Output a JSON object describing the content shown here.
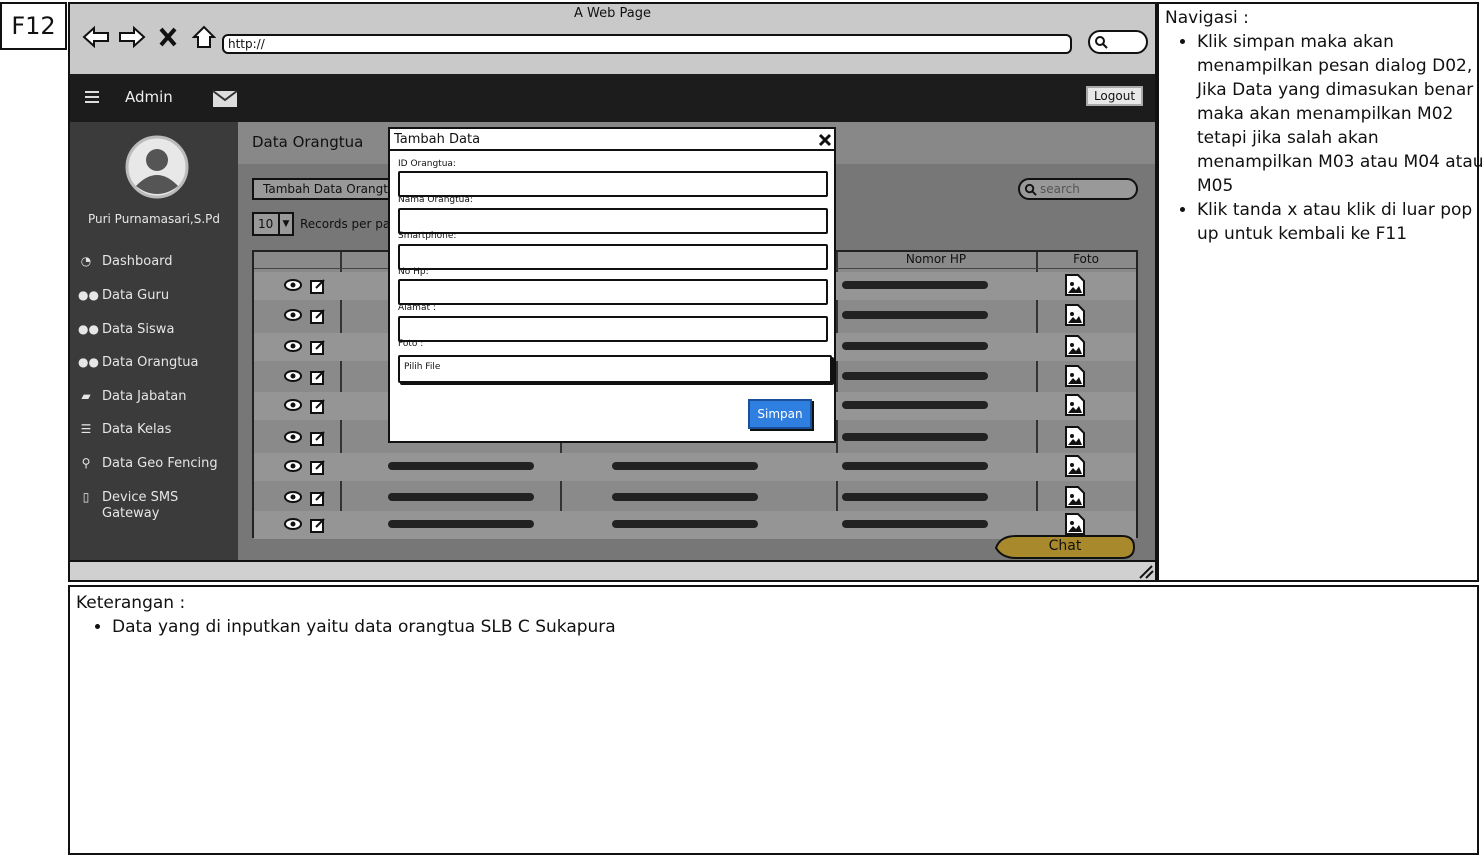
{
  "frame_id": "F12",
  "browser": {
    "title": "A Web Page",
    "url": "http://"
  },
  "topbar": {
    "menu_label": "Admin",
    "logout_label": "Logout"
  },
  "sidebar": {
    "user_name": "Puri Purnamasari,S.Pd",
    "items": [
      {
        "label": "Dashboard",
        "icon": "dashboard-icon"
      },
      {
        "label": "Data Guru",
        "icon": "users-icon"
      },
      {
        "label": "Data Siswa",
        "icon": "users-icon"
      },
      {
        "label": "Data Orangtua",
        "icon": "users-icon"
      },
      {
        "label": "Data Jabatan",
        "icon": "book-icon"
      },
      {
        "label": "Data Kelas",
        "icon": "list-icon"
      },
      {
        "label": "Data Geo Fencing",
        "icon": "map-pin-icon"
      },
      {
        "label": "Device SMS Gateway",
        "icon": "device-icon"
      }
    ]
  },
  "main": {
    "page_title": "Data Orangtua",
    "add_button": "Tambah Data Orangtua",
    "records_value": "10",
    "records_label": "Records per page",
    "search_placeholder": "search",
    "columns": [
      "Nomor HP",
      "Foto"
    ],
    "chat_label": "Chat"
  },
  "modal": {
    "title": "Tambah Data",
    "fields": [
      {
        "label": "ID Orangtua:"
      },
      {
        "label": "Nama Orangtua:"
      },
      {
        "label": "Smartphone:"
      },
      {
        "label": "No Hp:"
      },
      {
        "label": "Alamat :"
      }
    ],
    "foto_label": "Foto :",
    "file_button": "Pilih File",
    "submit_label": "Simpan"
  },
  "notes": {
    "title": "Navigasi :",
    "items": [
      "Klik simpan maka akan menampilkan pesan dialog D02, Jika Data yang dimasukan benar maka akan menampilkan M02 tetapi jika salah akan menampilkan M03 atau M04 atau M05",
      "Klik tanda x atau klik di luar pop up untuk kembali ke F11"
    ]
  },
  "keterangan": {
    "title": "Keterangan :",
    "items": [
      "Data yang di inputkan yaitu data orangtua SLB C Sukapura"
    ]
  },
  "colors": {
    "topbar": "#1c1c1c",
    "sidebar": "#3b3b3b",
    "content": "#777777",
    "primary_button": "#2f7fe0",
    "chat_bubble": "#a8892b"
  }
}
